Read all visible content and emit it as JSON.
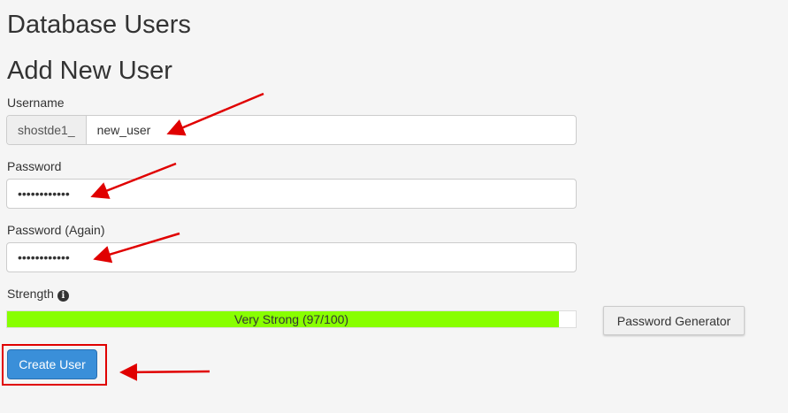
{
  "page": {
    "title": "Database Users",
    "subtitle": "Add New User"
  },
  "form": {
    "username_label": "Username",
    "username_prefix": "shostde1_",
    "username_value": "new_user",
    "password_label": "Password",
    "password_value": "secretpass12",
    "password_again_label": "Password (Again)",
    "password_again_value": "secretpass12",
    "strength_label": "Strength",
    "strength_text": "Very Strong (97/100)",
    "strength_score": 97,
    "strength_color": "#88ff00",
    "password_generator_label": "Password Generator",
    "create_user_label": "Create User"
  },
  "icons": {
    "strength_info": "info-icon"
  },
  "annotations": {
    "arrow_color": "#e00000",
    "highlight_color": "#e00000"
  }
}
